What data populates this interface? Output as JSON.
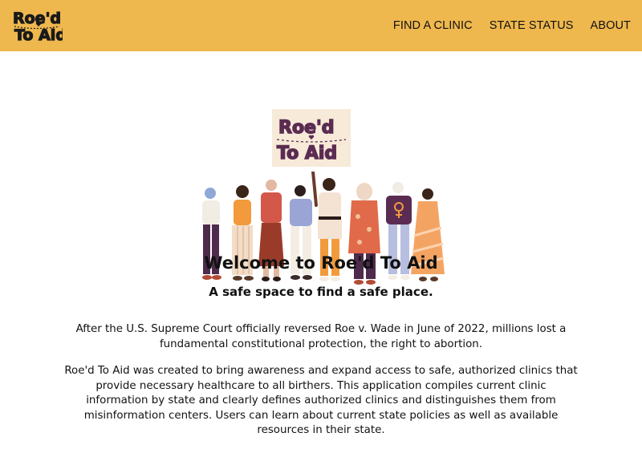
{
  "brand": {
    "logo_text": "Roe'd To Aid"
  },
  "nav": {
    "links": [
      {
        "label": "FIND A CLINIC"
      },
      {
        "label": "STATE STATUS"
      },
      {
        "label": "ABOUT"
      }
    ]
  },
  "hero": {
    "sign_text": "Roe'd To Aid"
  },
  "main": {
    "title": "Welcome to Roe'd To Aid",
    "subtitle": "A safe space to find a safe place.",
    "paragraphs": [
      "After the U.S. Supreme Court officially reversed Roe v. Wade in June of 2022, millions lost a fundamental constitutional protection, the right to abortion.",
      "Roe'd To Aid was created to bring awareness and expand access to safe, authorized clinics that provide necessary healthcare to all birthers. This application compiles current clinic information by state and clearly defines authorized clinics and distinguishes them from misinformation centers. Users can learn about current state policies as well as available resources in their state."
    ]
  },
  "colors": {
    "navbar": "#efb84e",
    "logo": "#1a1a1a",
    "sign_bg": "#f7ead9",
    "sign_text": "#5b2c52"
  }
}
